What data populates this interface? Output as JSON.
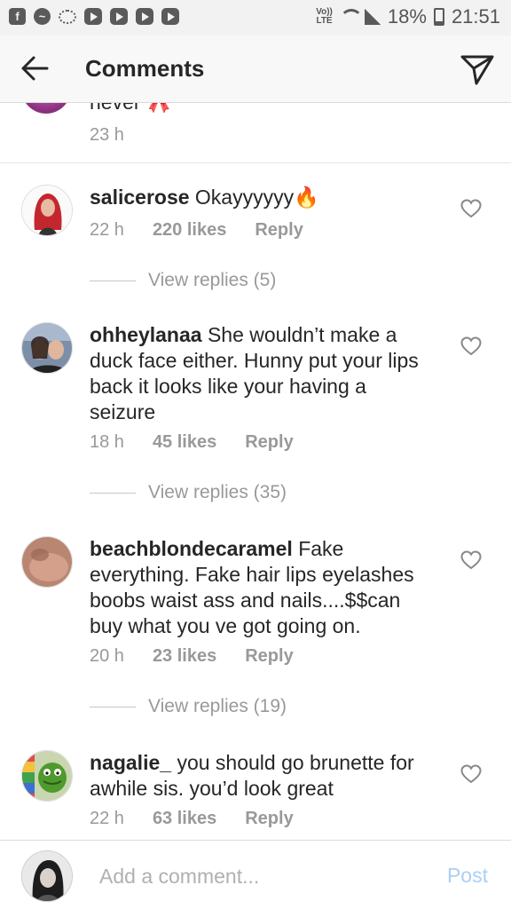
{
  "status_bar": {
    "lte_top": "Vo))",
    "lte_bottom": "LTE",
    "battery": "18%",
    "battery_level": 0.18,
    "time": "21:51",
    "app_icons": [
      "facebook-icon",
      "messenger-icon",
      "cloud-icon",
      "youtube-icon",
      "youtube-icon",
      "youtube-icon",
      "youtube-icon"
    ]
  },
  "header": {
    "title": "Comments"
  },
  "partial_comment": {
    "text": "never 🎀",
    "time": "23 h"
  },
  "comments": [
    {
      "username": "salicerose",
      "text": "Okayyyyyy🔥",
      "time": "22 h",
      "likes": "220 likes",
      "reply": "Reply",
      "view_replies": "View replies (5)"
    },
    {
      "username": "ohheylanaa",
      "text": "She wouldn’t make a duck face either. Hunny put your lips back it looks like your having a seizure",
      "time": "18 h",
      "likes": "45 likes",
      "reply": "Reply",
      "view_replies": "View replies (35)"
    },
    {
      "username": "beachblondecaramel",
      "text": "Fake everything. Fake hair lips eyelashes boobs waist ass and nails....$$can buy what you ve got going on.",
      "time": "20 h",
      "likes": "23 likes",
      "reply": "Reply",
      "view_replies": "View replies (19)"
    },
    {
      "username": "nagalie_",
      "text": "you should go brunette for awhile sis. you’d look great",
      "time": "22 h",
      "likes": "63 likes",
      "reply": "Reply"
    }
  ],
  "add_comment": {
    "placeholder": "Add a comment...",
    "post_label": "Post"
  },
  "colors": {
    "post_disabled": "#a9d0f5",
    "meta_gray": "#999999",
    "text": "#262626"
  }
}
